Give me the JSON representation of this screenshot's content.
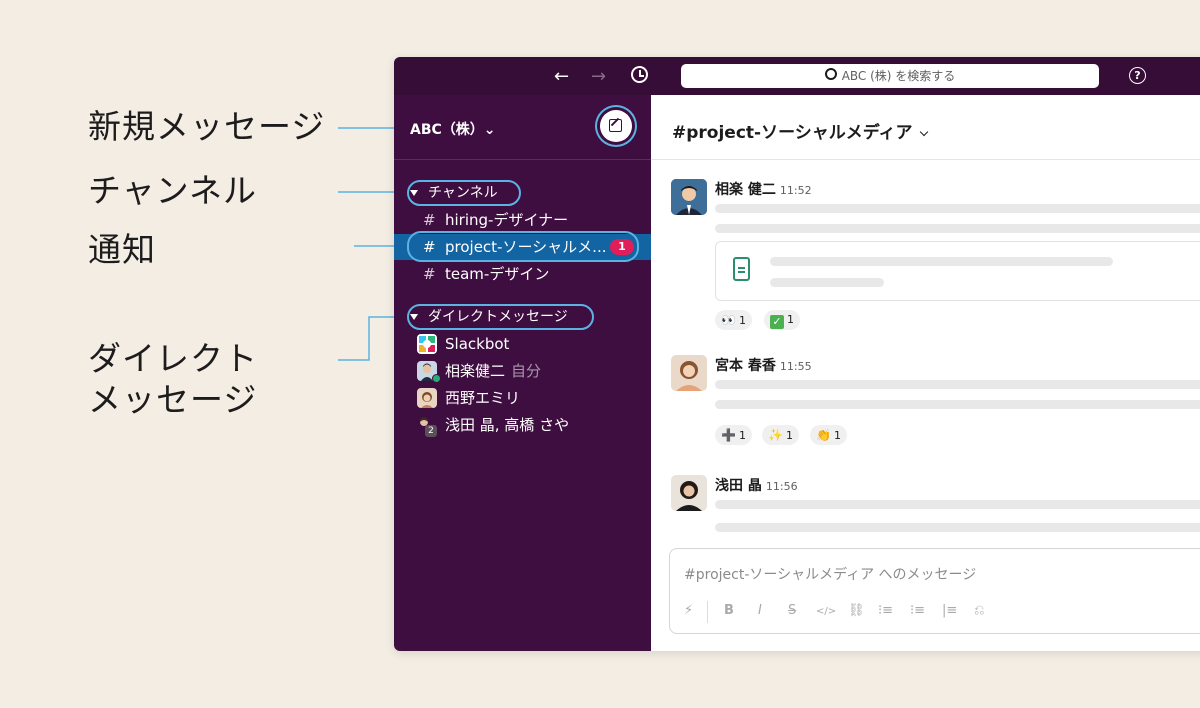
{
  "callouts": {
    "new_message": "新規メッセージ",
    "channels": "チャンネル",
    "notifications": "通知",
    "direct_line1": "ダイレクト",
    "direct_line2": "メッセージ"
  },
  "topbar": {
    "back": "←",
    "forward": "→",
    "search_text": "ABC (株) を検索する",
    "help": "?"
  },
  "sidebar": {
    "workspace": "ABC（株）⌄",
    "channels_header": "チャンネル",
    "channels": [
      {
        "hash": "#",
        "name": "hiring-デザイナー"
      },
      {
        "hash": "#",
        "name": "project-ソーシャルメ...",
        "badge": "1"
      },
      {
        "hash": "#",
        "name": "team-デザイン"
      }
    ],
    "dm_header": "ダイレクトメッセージ",
    "dms": [
      {
        "name": "Slackbot"
      },
      {
        "name": "相楽健二",
        "suffix": "自分"
      },
      {
        "name": "西野エミリ"
      },
      {
        "name": "浅田 晶, 高橋 さや",
        "count": "2"
      }
    ]
  },
  "main": {
    "channel_title": "#project-ソーシャルメディア",
    "messages": [
      {
        "name": "相楽 健二",
        "time": "11:52"
      },
      {
        "name": "宮本 春香",
        "time": "11:55"
      },
      {
        "name": "浅田 晶",
        "time": "11:56"
      }
    ],
    "reactions1": [
      {
        "emoji": "👀",
        "count": "1"
      },
      {
        "emoji": "✓",
        "count": "1"
      }
    ],
    "reactions2": [
      {
        "emoji": "➕",
        "count": "1"
      },
      {
        "emoji": "✨",
        "count": "1"
      },
      {
        "emoji": "👏",
        "count": "1"
      }
    ],
    "composer_placeholder": "#project-ソーシャルメディア へのメッセージ",
    "toolbar": {
      "bolt": "⚡",
      "bold": "B",
      "italic": "I",
      "strike": "S",
      "code": "</>",
      "link": "⛓",
      "ol": "⁝≡",
      "ul": "⁝≡",
      "quote": "|≡",
      "snippet": "⎌"
    }
  },
  "colors": {
    "aubergine": "#3f0e40",
    "topbar": "#350d36",
    "active": "#1264a3",
    "badge": "#e01e5a",
    "highlight": "#5bb3e2"
  }
}
